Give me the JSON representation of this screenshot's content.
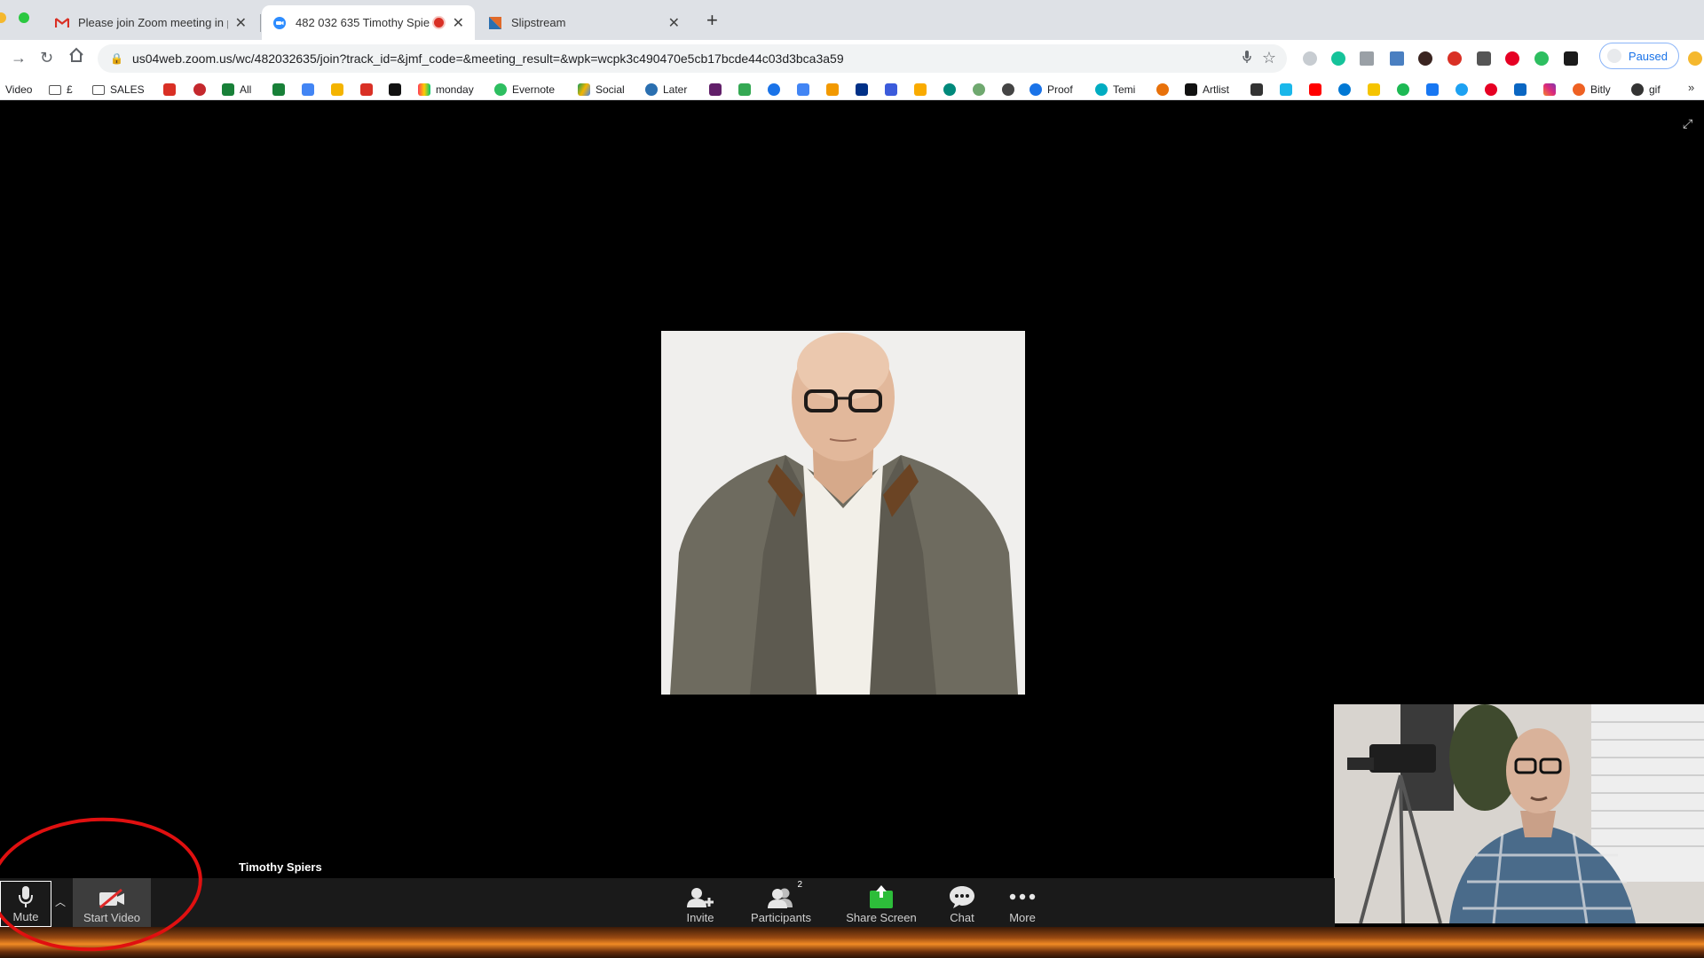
{
  "browser": {
    "tabs": [
      {
        "title": "Please join Zoom meeting in pr",
        "active": false
      },
      {
        "title": "482 032 635 Timothy Spie",
        "active": true
      },
      {
        "title": "Slipstream",
        "active": false
      }
    ],
    "url": "us04web.zoom.us/wc/482032635/join?track_id=&jmf_code=&meeting_result=&wpk=wcpk3c490470e5cb17bcde44c03d3bca3a59",
    "profile_label": "Paused",
    "bookmarks": [
      "Video",
      "£",
      "SALES",
      "All",
      "monday",
      "Evernote",
      "Social",
      "Later",
      "Proof",
      "Temi",
      "Artlist",
      "Bitly",
      "gif"
    ]
  },
  "meeting": {
    "participant_name": "Timothy Spiers",
    "participant_count": "2",
    "toolbar": {
      "mute": "Mute",
      "start_video": "Start Video",
      "invite": "Invite",
      "participants": "Participants",
      "share_screen": "Share Screen",
      "chat": "Chat",
      "more": "More"
    }
  },
  "colors": {
    "share_green": "#2dbd3a",
    "annotation_red": "#e01010",
    "paused_blue": "#1a73e8"
  }
}
